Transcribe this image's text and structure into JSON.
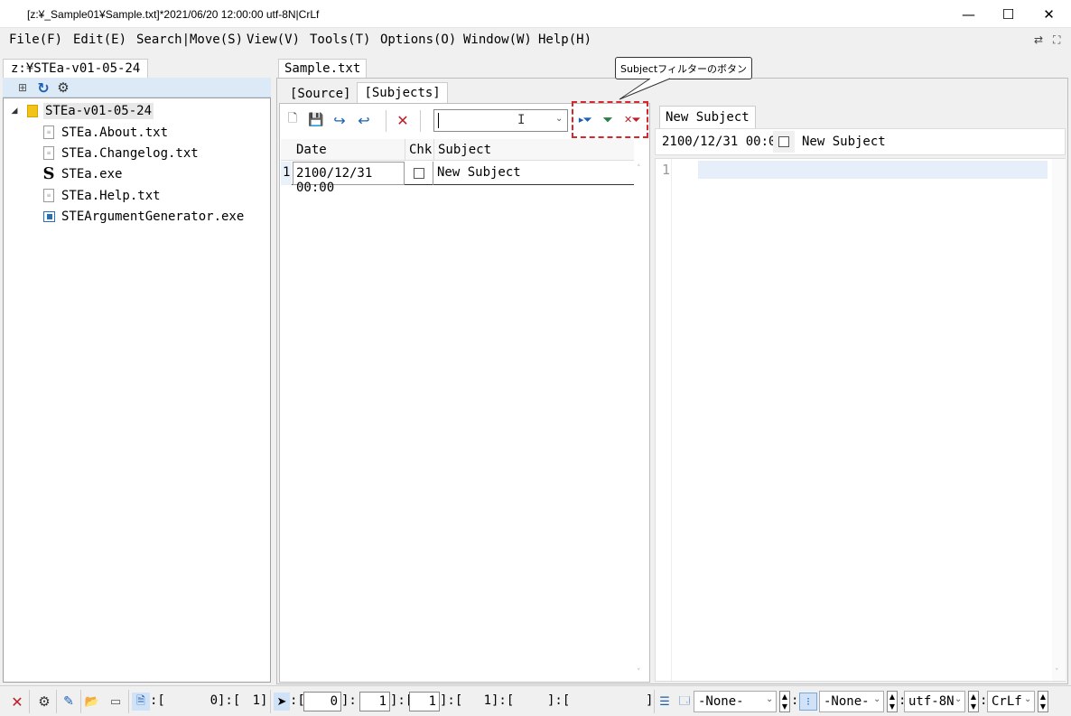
{
  "window": {
    "title": "[z:¥_Sample01¥Sample.txt]*2021/06/20 12:00:00 utf-8N|CrLf",
    "minimize": "—",
    "maximize": "☐",
    "close": "✕"
  },
  "menu": {
    "items": [
      "File(F)",
      "Edit(E)",
      "Search|Move(S)",
      "View(V)",
      "Tools(T)",
      "Options(O)",
      "Window(W)",
      "Help(H)"
    ]
  },
  "explorer": {
    "tab": "z:¥STEa-v01-05-24",
    "root": "STEa-v01-05-24",
    "files": [
      "STEa.About.txt",
      "STEa.Changelog.txt",
      "STEa.exe",
      "STEa.Help.txt",
      "STEArgumentGenerator.exe"
    ]
  },
  "document": {
    "tab": "Sample.txt",
    "subtabs": [
      "[Source]",
      "[Subjects]"
    ],
    "callout": "Subjectフィルターのボタン",
    "grid": {
      "headers": [
        "Date",
        "Chk",
        "Subject"
      ],
      "rows": [
        {
          "num": "1",
          "date": "2100/12/31 00:00",
          "subject": "New Subject"
        }
      ]
    },
    "editor": {
      "tab": "New Subject",
      "date": "2100/12/31 00:00",
      "subject": "New Subject",
      "line_number": "1"
    }
  },
  "statusbar": {
    "pos_open": ":[",
    "pos_val1": "0",
    "pos_sep": "]:[",
    "pos_val2": "1",
    "pos_close": "]",
    "cursor_val1": "0",
    "cursor_val2": "1",
    "cursor_val3": "1",
    "cursor_val4": "1",
    "combo1": "-None-",
    "combo2": "-None-",
    "encoding": "utf-8N",
    "eol": "CrLf"
  }
}
